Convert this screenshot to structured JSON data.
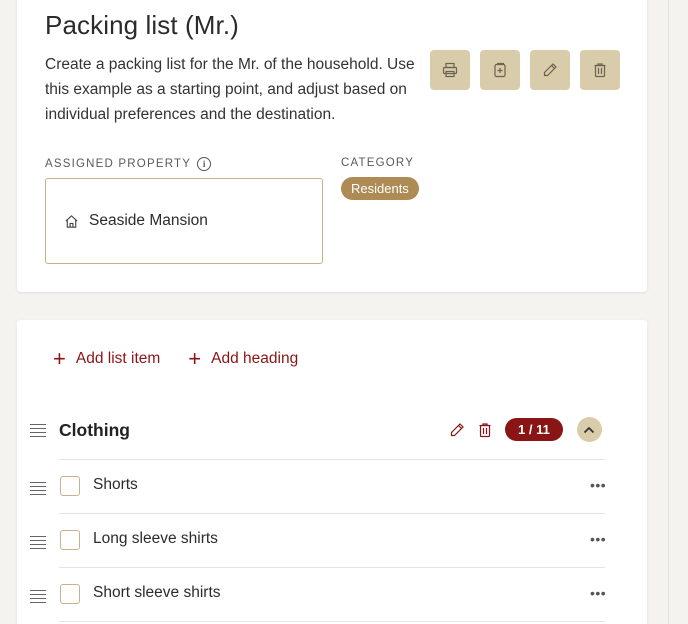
{
  "header": {
    "title": "Packing list (Mr.)",
    "description": "Create a packing list for the Mr. of the household. Use this example as a starting point, and adjust based on individual preferences and the destination."
  },
  "actions": {
    "print_icon": "printer-icon",
    "duplicate_icon": "duplicate-icon",
    "edit_icon": "pencil-icon",
    "delete_icon": "trash-icon"
  },
  "assigned_property": {
    "label": "ASSIGNED PROPERTY",
    "info": "i",
    "value": "Seaside Mansion",
    "icon": "house-icon"
  },
  "category": {
    "label": "CATEGORY",
    "value": "Residents"
  },
  "list_toolbar": {
    "add_item_label": "Add list item",
    "add_heading_label": "Add heading",
    "plus": "+"
  },
  "group": {
    "title": "Clothing",
    "count": "1 / 11"
  },
  "items": [
    {
      "label": "Shorts",
      "more": "•••"
    },
    {
      "label": "Long sleeve shirts",
      "more": "•••"
    },
    {
      "label": "Short sleeve shirts",
      "more": "•••"
    }
  ],
  "colors": {
    "accent": "#8a1515",
    "button_bg": "#d9ccaa",
    "badge": "#ae8a55",
    "border": "#c9b08a"
  }
}
